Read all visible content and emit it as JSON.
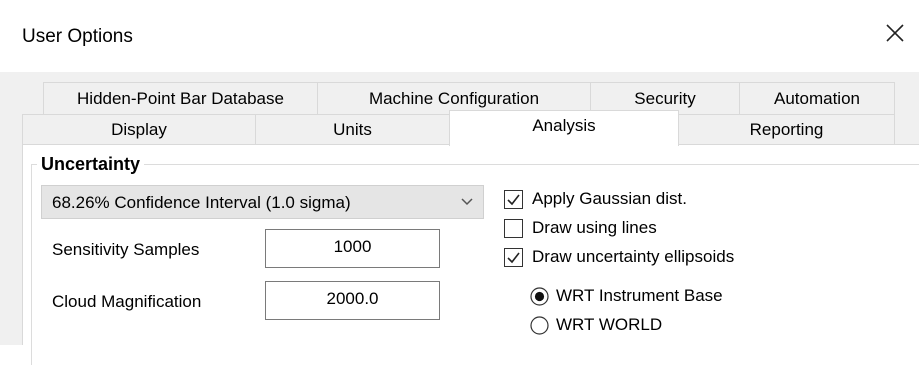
{
  "window": {
    "title": "User Options",
    "close_icon": "close-icon"
  },
  "tabs_back_row": [
    {
      "label": "Hidden-Point Bar Database"
    },
    {
      "label": "Machine Configuration"
    },
    {
      "label": "Security"
    },
    {
      "label": "Automation"
    }
  ],
  "tabs_front_row": [
    {
      "label": "Display"
    },
    {
      "label": "Units"
    },
    {
      "label": "Analysis",
      "active": true
    },
    {
      "label": "Reporting"
    }
  ],
  "uncertainty": {
    "group_label": "Uncertainty",
    "confidence_select": {
      "value": "68.26% Confidence Interval (1.0 sigma)",
      "arrow_icon": "chevron-down-icon"
    },
    "sensitivity_samples": {
      "label": "Sensitivity Samples",
      "value": "1000"
    },
    "cloud_magnification": {
      "label": "Cloud Magnification",
      "value": "2000.0"
    },
    "checkboxes": [
      {
        "label": "Apply Gaussian dist.",
        "checked": true
      },
      {
        "label": "Draw using lines",
        "checked": false
      },
      {
        "label": "Draw uncertainty ellipsoids",
        "checked": true
      }
    ],
    "radios": [
      {
        "label": "WRT Instrument Base",
        "selected": true
      },
      {
        "label": "WRT WORLD",
        "selected": false
      }
    ]
  }
}
